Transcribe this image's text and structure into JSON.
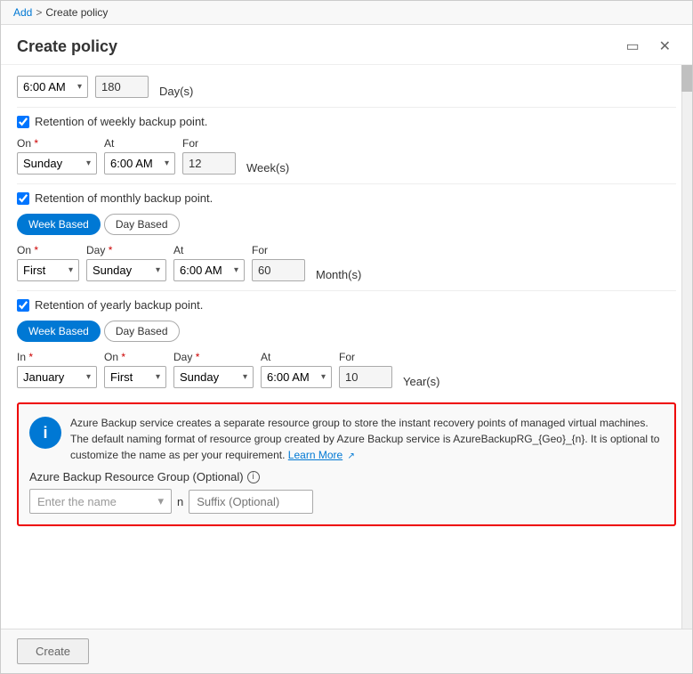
{
  "breadcrumb": {
    "add_label": "Add",
    "separator": ">",
    "current_label": "Create policy"
  },
  "panel": {
    "title": "Create policy",
    "window_icon": "▭",
    "close_icon": "✕"
  },
  "top_section": {
    "time_value": "6:00 AM",
    "days_value": "180",
    "days_unit": "Day(s)"
  },
  "weekly": {
    "checkbox_label": "Retention of weekly backup point.",
    "on_label": "On",
    "at_label": "At",
    "for_label": "For",
    "on_value": "Sunday",
    "at_value": "6:00 AM",
    "for_value": "12",
    "unit": "Week(s)"
  },
  "monthly": {
    "checkbox_label": "Retention of monthly backup point.",
    "tab_week": "Week Based",
    "tab_day": "Day Based",
    "on_label": "On",
    "day_label": "Day",
    "at_label": "At",
    "for_label": "For",
    "on_value": "First",
    "day_value": "Sunday",
    "at_value": "6:00 AM",
    "for_value": "60",
    "unit": "Month(s)"
  },
  "yearly": {
    "checkbox_label": "Retention of yearly backup point.",
    "tab_week": "Week Based",
    "tab_day": "Day Based",
    "in_label": "In",
    "on_label": "On",
    "day_label": "Day",
    "at_label": "At",
    "for_label": "For",
    "in_value": "January",
    "on_value": "First",
    "day_value": "Sunday",
    "at_value": "6:00 AM",
    "for_value": "10",
    "unit": "Year(s)"
  },
  "info_box": {
    "icon": "i",
    "text_part1": "Azure Backup service creates a separate resource group to store the instant recovery points of managed virtual machines. The default naming format of resource group created by Azure Backup service is AzureBackupRG_{Geo}_{n}. It is optional to customize the name as per your requirement.",
    "learn_more": "Learn More",
    "external_link_icon": "↗"
  },
  "resource_group": {
    "label": "Azure Backup Resource Group (Optional)",
    "info_icon": "i",
    "name_placeholder": "Enter the name",
    "separator": "n",
    "suffix_placeholder": "Suffix (Optional)"
  },
  "footer": {
    "create_label": "Create"
  }
}
